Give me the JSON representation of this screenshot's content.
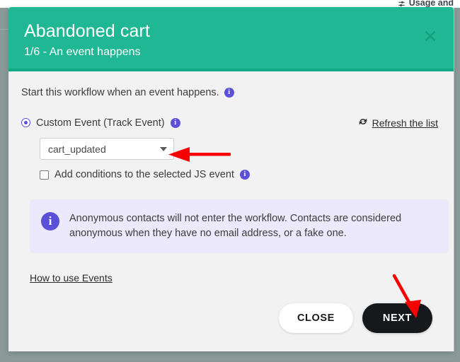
{
  "background": {
    "nav_item_label": "Usage and",
    "nav_item_icon": "settings-sliders-icon"
  },
  "modal": {
    "title": "Abandoned cart",
    "subtitle": "1/6 - An event happens",
    "close_icon": "close-icon",
    "header_color": "#20b894",
    "header_border_color": "#11a886",
    "body": {
      "intro_text": "Start this workflow when an event happens.",
      "intro_info_icon": "info-icon",
      "radio": {
        "label": "Custom Event (Track Event)",
        "checked": true,
        "info_icon": "info-icon"
      },
      "refresh": {
        "label": "Refresh the list",
        "icon": "refresh-icon"
      },
      "event_select": {
        "value": "cart_updated",
        "caret_icon": "chevron-down-icon"
      },
      "conditions_checkbox": {
        "label": "Add conditions to the selected JS event",
        "checked": false,
        "info_icon": "info-icon"
      },
      "notice": {
        "icon": "info-icon",
        "text": "Anonymous contacts will not enter the workflow. Contacts are considered anonymous when they have no email address, or a fake one.",
        "background_color": "#ebe9fb",
        "icon_color": "#5b51d8"
      },
      "help_link": "How to use Events"
    },
    "footer": {
      "close_label": "CLOSE",
      "next_label": "NEXT",
      "next_color": "#16191c"
    }
  },
  "annotations": {
    "color": "#fb0000",
    "arrow_to_select": "arrow-pointing-left-at-event-dropdown",
    "arrow_to_next": "arrow-pointing-down-at-next-button"
  }
}
